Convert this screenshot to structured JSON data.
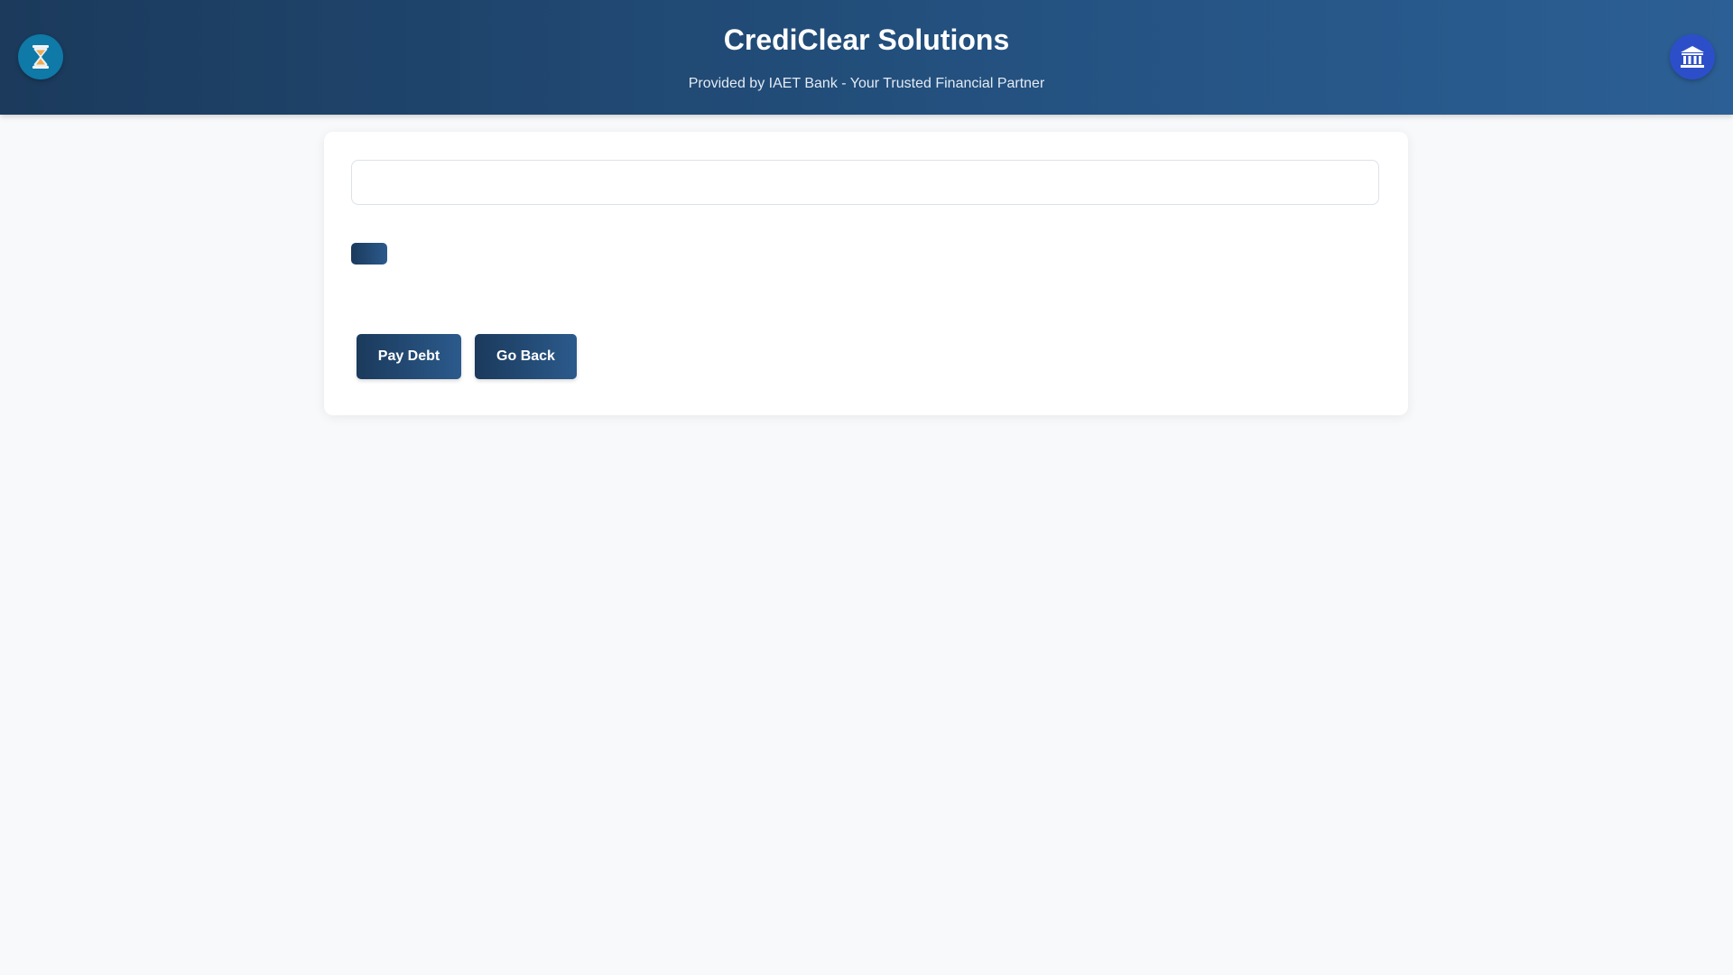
{
  "header": {
    "title": "CrediClear Solutions",
    "subtitle": "Provided by IAET Bank - Your Trusted Financial Partner",
    "left_icon": "hourglass-icon",
    "right_icon": "bank-icon"
  },
  "form": {
    "input_value": "",
    "small_button_label": "",
    "buttons": {
      "pay_label": "Pay Debt",
      "back_label": "Go Back"
    }
  },
  "colors": {
    "header_start": "#1b3a5c",
    "header_end": "#2c5f95",
    "button": "#1f4470",
    "background": "#f8f9fb",
    "hourglass_circle": "#0f79a8",
    "bank_circle": "#2c4fc9"
  }
}
